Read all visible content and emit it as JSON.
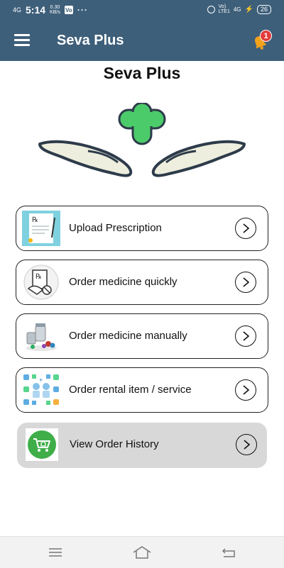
{
  "status_bar": {
    "signal": "4G",
    "time": "5:14",
    "net_rate": "0.30",
    "net_rate_unit": "KB/s",
    "carrier_badge": "Vo",
    "more": "···",
    "volte": "Vo)\nLTE1",
    "network": "4G",
    "battery": "26"
  },
  "app_bar": {
    "title": "Seva Plus",
    "notification_count": "1"
  },
  "page": {
    "title": "Seva Plus"
  },
  "options": [
    {
      "label": "Upload Prescription",
      "icon": "prescription-icon"
    },
    {
      "label": "Order medicine quickly",
      "icon": "quick-order-icon"
    },
    {
      "label": "Order medicine manually",
      "icon": "medicine-bottles-icon"
    },
    {
      "label": "Order rental item / service",
      "icon": "medical-equipment-icon"
    },
    {
      "label": "View Order History",
      "icon": "cart-history-icon"
    }
  ],
  "colors": {
    "app_bar": "#3e5f7a",
    "logo_cross": "#4ccb6b",
    "notification_bell": "#f2a21b",
    "badge": "#e23b3b",
    "history_card": "#d8d8d8"
  }
}
